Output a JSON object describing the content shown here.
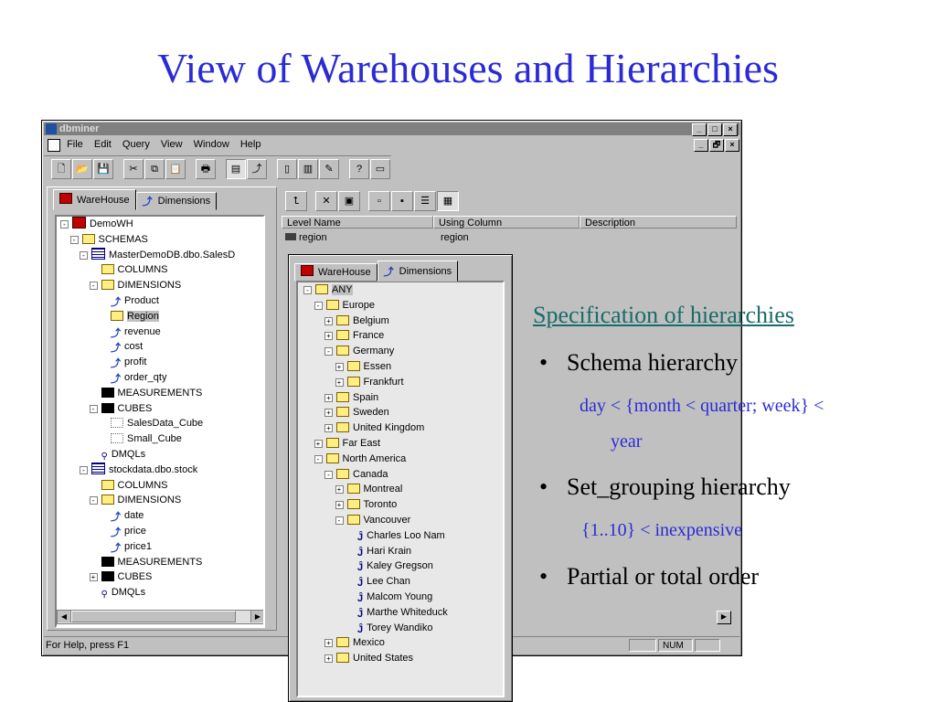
{
  "slide": {
    "title": "View of Warehouses and Hierarchies",
    "spec_heading": "Specification of hierarchies",
    "bullets": [
      "Schema hierarchy",
      "Set_grouping hierarchy",
      "Partial or total order"
    ],
    "schema_example_line1": "day < {month < quarter; week} <",
    "schema_example_line2": "year",
    "set_grouping_example": "{1..10} < inexpensive",
    "bullet_symbol": "•"
  },
  "window": {
    "title": "dbminer",
    "menu": [
      "File",
      "Edit",
      "Query",
      "View",
      "Window",
      "Help"
    ],
    "window_controls": [
      "_",
      "□",
      "×"
    ],
    "mdi_controls": [
      "_",
      "🗗",
      "×"
    ],
    "toolbar_glyphs": [
      "🗋",
      "📂",
      "💾",
      "✂",
      "⧉",
      "📋",
      "🖶",
      "▤",
      "⤴",
      "▯",
      "▥",
      "✎",
      "?",
      "▭"
    ],
    "status": "For Help, press F1",
    "status_num": "NUM"
  },
  "left_tabs": [
    "WareHouse",
    "Dimensions"
  ],
  "left_tree": [
    {
      "label": "DemoWH",
      "indent": 0,
      "pm": "-",
      "icon": "db"
    },
    {
      "label": "SCHEMAS",
      "indent": 1,
      "pm": "-",
      "icon": "folder"
    },
    {
      "label": "MasterDemoDB.dbo.SalesD",
      "indent": 2,
      "pm": "-",
      "icon": "table"
    },
    {
      "label": "COLUMNS",
      "indent": 3,
      "pm": "",
      "icon": "folder"
    },
    {
      "label": "DIMENSIONS",
      "indent": 3,
      "pm": "-",
      "icon": "folder"
    },
    {
      "label": "Product",
      "indent": 4,
      "pm": "",
      "icon": "dim"
    },
    {
      "label": "Region",
      "indent": 4,
      "pm": "",
      "icon": "folder",
      "selected": true
    },
    {
      "label": "revenue",
      "indent": 4,
      "pm": "",
      "icon": "dim"
    },
    {
      "label": "cost",
      "indent": 4,
      "pm": "",
      "icon": "dim"
    },
    {
      "label": "profit",
      "indent": 4,
      "pm": "",
      "icon": "dim"
    },
    {
      "label": "order_qty",
      "indent": 4,
      "pm": "",
      "icon": "dim"
    },
    {
      "label": "MEASUREMENTS",
      "indent": 3,
      "pm": "",
      "icon": "meas"
    },
    {
      "label": "CUBES",
      "indent": 3,
      "pm": "-",
      "icon": "meas"
    },
    {
      "label": "SalesData_Cube",
      "indent": 4,
      "pm": "",
      "icon": "cube"
    },
    {
      "label": "Small_Cube",
      "indent": 4,
      "pm": "",
      "icon": "cube"
    },
    {
      "label": "DMQLs",
      "indent": 3,
      "pm": "",
      "icon": "key"
    },
    {
      "label": "stockdata.dbo.stock",
      "indent": 2,
      "pm": "-",
      "icon": "table"
    },
    {
      "label": "COLUMNS",
      "indent": 3,
      "pm": "",
      "icon": "folder"
    },
    {
      "label": "DIMENSIONS",
      "indent": 3,
      "pm": "-",
      "icon": "folder"
    },
    {
      "label": "date",
      "indent": 4,
      "pm": "",
      "icon": "dim"
    },
    {
      "label": "price",
      "indent": 4,
      "pm": "",
      "icon": "dim"
    },
    {
      "label": "price1",
      "indent": 4,
      "pm": "",
      "icon": "dim"
    },
    {
      "label": "MEASUREMENTS",
      "indent": 3,
      "pm": "",
      "icon": "meas"
    },
    {
      "label": "CUBES",
      "indent": 3,
      "pm": "+",
      "icon": "meas"
    },
    {
      "label": "DMQLs",
      "indent": 3,
      "pm": "",
      "icon": "key"
    }
  ],
  "list": {
    "columns": [
      "Level Name",
      "Using Column",
      "Description"
    ],
    "rows": [
      [
        "region",
        "region",
        ""
      ]
    ]
  },
  "overlay_tabs": [
    "WareHouse",
    "Dimensions"
  ],
  "overlay_tree": [
    {
      "label": "ANY",
      "indent": 0,
      "pm": "-",
      "icon": "folder",
      "selected": true
    },
    {
      "label": "Europe",
      "indent": 1,
      "pm": "-",
      "icon": "folder"
    },
    {
      "label": "Belgium",
      "indent": 2,
      "pm": "+",
      "icon": "folder"
    },
    {
      "label": "France",
      "indent": 2,
      "pm": "+",
      "icon": "folder"
    },
    {
      "label": "Germany",
      "indent": 2,
      "pm": "-",
      "icon": "folder"
    },
    {
      "label": "Essen",
      "indent": 3,
      "pm": "+",
      "icon": "folder"
    },
    {
      "label": "Frankfurt",
      "indent": 3,
      "pm": "+",
      "icon": "folder"
    },
    {
      "label": "Spain",
      "indent": 2,
      "pm": "+",
      "icon": "folder"
    },
    {
      "label": "Sweden",
      "indent": 2,
      "pm": "+",
      "icon": "folder"
    },
    {
      "label": "United Kingdom",
      "indent": 2,
      "pm": "+",
      "icon": "folder"
    },
    {
      "label": "Far East",
      "indent": 1,
      "pm": "+",
      "icon": "folder"
    },
    {
      "label": "North America",
      "indent": 1,
      "pm": "-",
      "icon": "folder"
    },
    {
      "label": "Canada",
      "indent": 2,
      "pm": "-",
      "icon": "folder"
    },
    {
      "label": "Montreal",
      "indent": 3,
      "pm": "+",
      "icon": "folder"
    },
    {
      "label": "Toronto",
      "indent": 3,
      "pm": "+",
      "icon": "folder"
    },
    {
      "label": "Vancouver",
      "indent": 3,
      "pm": "-",
      "icon": "folder"
    },
    {
      "label": "Charles Loo Nam",
      "indent": 4,
      "pm": "",
      "icon": "person"
    },
    {
      "label": "Hari Krain",
      "indent": 4,
      "pm": "",
      "icon": "person"
    },
    {
      "label": "Kaley Gregson",
      "indent": 4,
      "pm": "",
      "icon": "person"
    },
    {
      "label": "Lee Chan",
      "indent": 4,
      "pm": "",
      "icon": "person"
    },
    {
      "label": "Malcom Young",
      "indent": 4,
      "pm": "",
      "icon": "person"
    },
    {
      "label": "Marthe Whiteduck",
      "indent": 4,
      "pm": "",
      "icon": "person"
    },
    {
      "label": "Torey Wandiko",
      "indent": 4,
      "pm": "",
      "icon": "person"
    },
    {
      "label": "Mexico",
      "indent": 2,
      "pm": "+",
      "icon": "folder"
    },
    {
      "label": "United States",
      "indent": 2,
      "pm": "+",
      "icon": "folder"
    }
  ]
}
